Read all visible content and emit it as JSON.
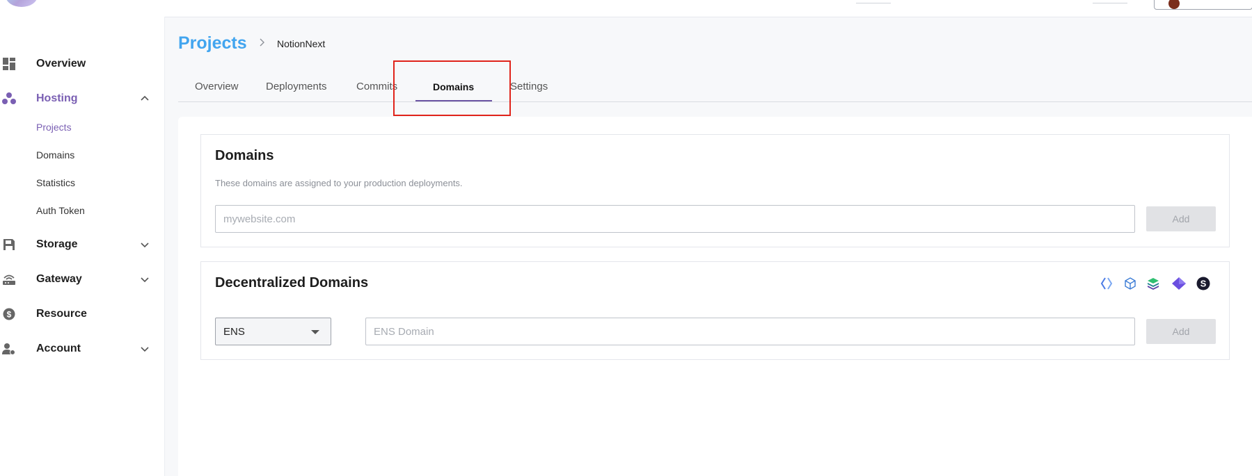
{
  "sidebar": {
    "items": [
      {
        "label": "Overview",
        "icon": "dashboard-icon"
      },
      {
        "label": "Hosting",
        "icon": "hosting-icon",
        "expanded": true,
        "children": [
          "Projects",
          "Domains",
          "Statistics",
          "Auth Token"
        ]
      },
      {
        "label": "Storage",
        "icon": "storage-icon"
      },
      {
        "label": "Gateway",
        "icon": "gateway-icon"
      },
      {
        "label": "Resource",
        "icon": "resource-icon"
      },
      {
        "label": "Account",
        "icon": "account-icon"
      }
    ],
    "active_color": "#7a5fb3"
  },
  "breadcrumb": {
    "root": "Projects",
    "project": "NotionNext",
    "root_color": "#42a5ef"
  },
  "tabs": [
    "Overview",
    "Deployments",
    "Commits",
    "Domains",
    "Settings"
  ],
  "active_tab": "Domains",
  "domains_card": {
    "title": "Domains",
    "description": "These domains are assigned to your production deployments.",
    "input_placeholder": "mywebsite.com",
    "add_label": "Add"
  },
  "decentralized_card": {
    "title": "Decentralized Domains",
    "select_value": "ENS",
    "input_placeholder": "ENS Domain",
    "add_label": "Add",
    "provider_icons": [
      "ens-icon",
      "cube-icon",
      "stacked-layers-icon",
      "polygon-diamond-icon",
      "s-logo-icon"
    ]
  },
  "highlight_color": "#e0231a"
}
